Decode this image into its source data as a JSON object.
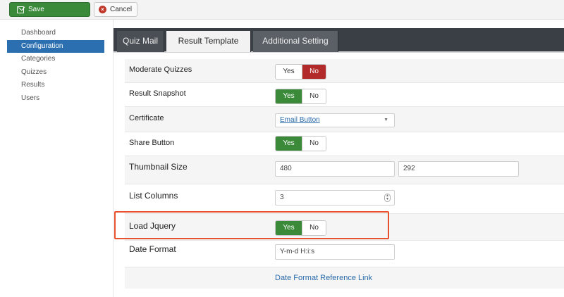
{
  "toolbar": {
    "save_label": "Save",
    "cancel_label": "Cancel"
  },
  "sidebar": {
    "items": [
      {
        "label": "Dashboard"
      },
      {
        "label": "Configuration"
      },
      {
        "label": "Categories"
      },
      {
        "label": "Quizzes"
      },
      {
        "label": "Results"
      },
      {
        "label": "Users"
      }
    ]
  },
  "tabs": [
    {
      "label": "Quiz Mail"
    },
    {
      "label": "Result Template"
    },
    {
      "label": "Additional Setting"
    }
  ],
  "settings": {
    "moderate_quizzes": {
      "label": "Moderate Quizzes",
      "yes": "Yes",
      "no": "No",
      "value": "No"
    },
    "result_snapshot": {
      "label": "Result Snapshot",
      "yes": "Yes",
      "no": "No",
      "value": "Yes"
    },
    "certificate": {
      "label": "Certificate",
      "value": "Email Button"
    },
    "share_button": {
      "label": "Share Button",
      "yes": "Yes",
      "no": "No",
      "value": "Yes"
    },
    "thumbnail_size": {
      "label": "Thumbnail Size",
      "width": "480",
      "height": "292"
    },
    "list_columns": {
      "label": "List Columns",
      "value": "3"
    },
    "load_jquery": {
      "label": "Load Jquery",
      "yes": "Yes",
      "no": "No",
      "value": "Yes"
    },
    "date_format": {
      "label": "Date Format",
      "value": "Y-m-d H:i:s"
    },
    "date_format_link": "Date Format Reference Link"
  },
  "colors": {
    "accent_blue": "#2c6fb0",
    "toggle_green": "#3a8a3a",
    "toggle_red": "#b22a2a",
    "highlight": "#e8512f",
    "tab_bar": "#3a3f45"
  },
  "icons": {
    "save": "pencil-square-icon",
    "cancel": "cancel-circle-icon",
    "select_caret": "chevron-down-icon",
    "number_spinner": "spinner-icon"
  }
}
